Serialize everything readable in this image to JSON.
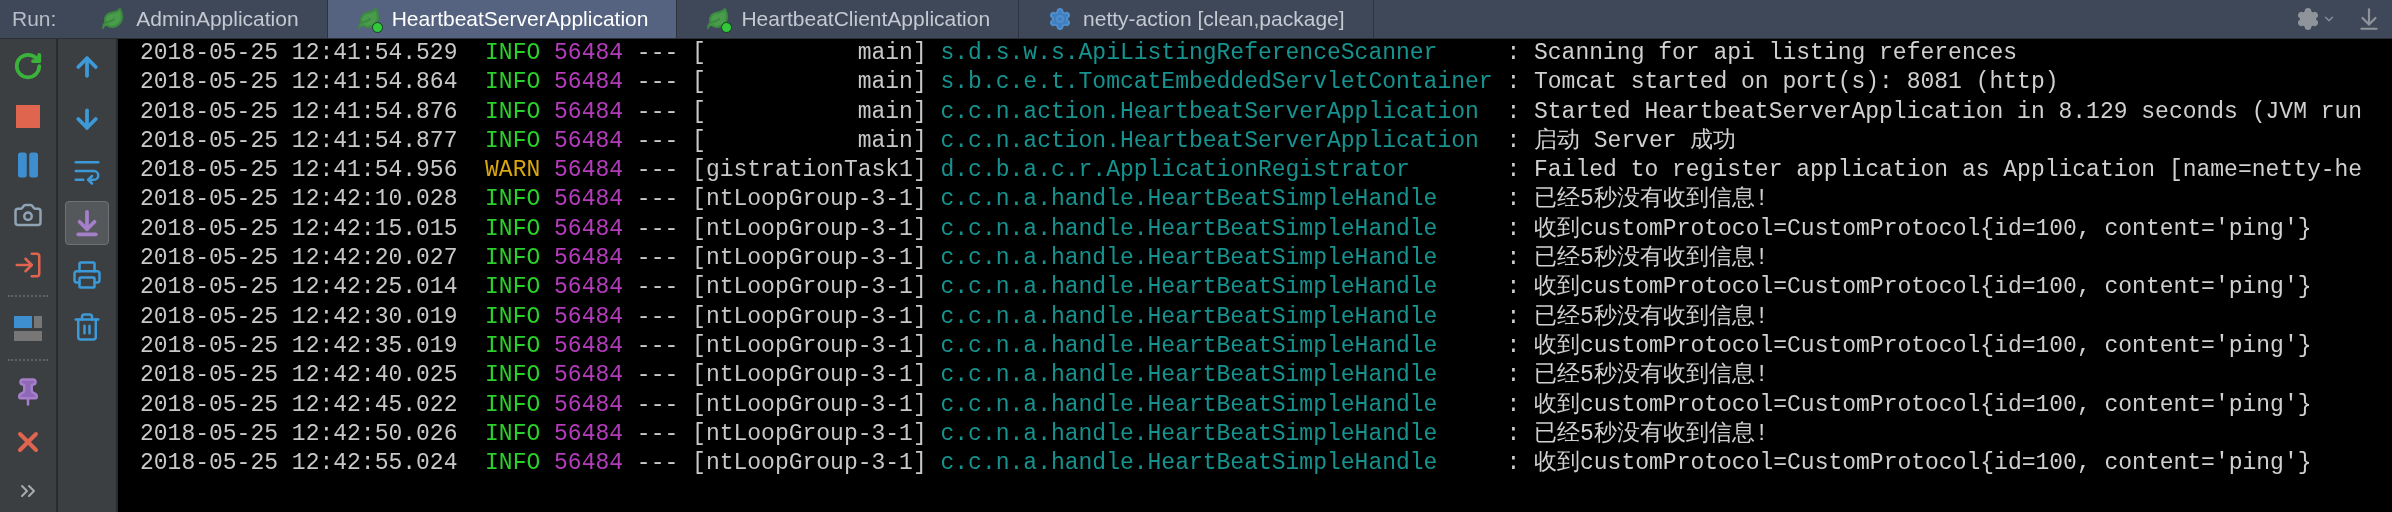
{
  "run_label": "Run:",
  "tabs": [
    {
      "label": "AdminApplication",
      "kind": "spring",
      "running": false,
      "selected": false
    },
    {
      "label": "HeartbeatServerApplication",
      "kind": "spring",
      "running": true,
      "selected": true
    },
    {
      "label": "HeartbeatClientApplication",
      "kind": "spring",
      "running": true,
      "selected": false
    },
    {
      "label": "netty-action [clean,package]",
      "kind": "maven",
      "running": false,
      "selected": false
    }
  ],
  "toolbar_left": [
    {
      "kind": "rerun"
    },
    {
      "kind": "stop"
    },
    {
      "kind": "pause"
    },
    {
      "kind": "camera"
    },
    {
      "kind": "exit"
    },
    {
      "kind": "sep"
    },
    {
      "kind": "layout"
    },
    {
      "kind": "sep"
    },
    {
      "kind": "pin"
    },
    {
      "kind": "close"
    },
    {
      "kind": "more"
    }
  ],
  "toolbar_right": [
    {
      "kind": "up",
      "selected": false
    },
    {
      "kind": "down",
      "selected": false
    },
    {
      "kind": "wrap",
      "selected": false
    },
    {
      "kind": "scroll-end",
      "selected": true
    },
    {
      "kind": "print",
      "selected": false
    },
    {
      "kind": "trash",
      "selected": false
    }
  ],
  "log": [
    {
      "time": "2018-05-25 12:41:54.529",
      "level": "INFO",
      "kind": "info",
      "pid": "56484",
      "dashes": "---",
      "thread": "[           main]",
      "logger": "s.d.s.w.s.ApiListingReferenceScanner",
      "message": ": Scanning for api listing references"
    },
    {
      "time": "2018-05-25 12:41:54.864",
      "level": "INFO",
      "kind": "info",
      "pid": "56484",
      "dashes": "---",
      "thread": "[           main]",
      "logger": "s.b.c.e.t.TomcatEmbeddedServletContainer",
      "message": ": Tomcat started on port(s): 8081 (http)"
    },
    {
      "time": "2018-05-25 12:41:54.876",
      "level": "INFO",
      "kind": "info",
      "pid": "56484",
      "dashes": "---",
      "thread": "[           main]",
      "logger": "c.c.n.action.HeartbeatServerApplication",
      "message": ": Started HeartbeatServerApplication in 8.129 seconds (JVM run"
    },
    {
      "time": "2018-05-25 12:41:54.877",
      "level": "INFO",
      "kind": "info",
      "pid": "56484",
      "dashes": "---",
      "thread": "[           main]",
      "logger": "c.c.n.action.HeartbeatServerApplication",
      "message": ": 启动 Server 成功"
    },
    {
      "time": "2018-05-25 12:41:54.956",
      "level": "WARN",
      "kind": "warn",
      "pid": "56484",
      "dashes": "---",
      "thread": "[gistrationTask1]",
      "logger": "d.c.b.a.c.r.ApplicationRegistrator",
      "message": ": Failed to register application as Application [name=netty-he"
    },
    {
      "time": "2018-05-25 12:42:10.028",
      "level": "INFO",
      "kind": "info",
      "pid": "56484",
      "dashes": "---",
      "thread": "[ntLoopGroup-3-1]",
      "logger": "c.c.n.a.handle.HeartBeatSimpleHandle",
      "message": ": 已经5秒没有收到信息!"
    },
    {
      "time": "2018-05-25 12:42:15.015",
      "level": "INFO",
      "kind": "info",
      "pid": "56484",
      "dashes": "---",
      "thread": "[ntLoopGroup-3-1]",
      "logger": "c.c.n.a.handle.HeartBeatSimpleHandle",
      "message": ": 收到customProtocol=CustomProtocol{id=100, content='ping'}"
    },
    {
      "time": "2018-05-25 12:42:20.027",
      "level": "INFO",
      "kind": "info",
      "pid": "56484",
      "dashes": "---",
      "thread": "[ntLoopGroup-3-1]",
      "logger": "c.c.n.a.handle.HeartBeatSimpleHandle",
      "message": ": 已经5秒没有收到信息!"
    },
    {
      "time": "2018-05-25 12:42:25.014",
      "level": "INFO",
      "kind": "info",
      "pid": "56484",
      "dashes": "---",
      "thread": "[ntLoopGroup-3-1]",
      "logger": "c.c.n.a.handle.HeartBeatSimpleHandle",
      "message": ": 收到customProtocol=CustomProtocol{id=100, content='ping'}"
    },
    {
      "time": "2018-05-25 12:42:30.019",
      "level": "INFO",
      "kind": "info",
      "pid": "56484",
      "dashes": "---",
      "thread": "[ntLoopGroup-3-1]",
      "logger": "c.c.n.a.handle.HeartBeatSimpleHandle",
      "message": ": 已经5秒没有收到信息!"
    },
    {
      "time": "2018-05-25 12:42:35.019",
      "level": "INFO",
      "kind": "info",
      "pid": "56484",
      "dashes": "---",
      "thread": "[ntLoopGroup-3-1]",
      "logger": "c.c.n.a.handle.HeartBeatSimpleHandle",
      "message": ": 收到customProtocol=CustomProtocol{id=100, content='ping'}"
    },
    {
      "time": "2018-05-25 12:42:40.025",
      "level": "INFO",
      "kind": "info",
      "pid": "56484",
      "dashes": "---",
      "thread": "[ntLoopGroup-3-1]",
      "logger": "c.c.n.a.handle.HeartBeatSimpleHandle",
      "message": ": 已经5秒没有收到信息!"
    },
    {
      "time": "2018-05-25 12:42:45.022",
      "level": "INFO",
      "kind": "info",
      "pid": "56484",
      "dashes": "---",
      "thread": "[ntLoopGroup-3-1]",
      "logger": "c.c.n.a.handle.HeartBeatSimpleHandle",
      "message": ": 收到customProtocol=CustomProtocol{id=100, content='ping'}"
    },
    {
      "time": "2018-05-25 12:42:50.026",
      "level": "INFO",
      "kind": "info",
      "pid": "56484",
      "dashes": "---",
      "thread": "[ntLoopGroup-3-1]",
      "logger": "c.c.n.a.handle.HeartBeatSimpleHandle",
      "message": ": 已经5秒没有收到信息!"
    },
    {
      "time": "2018-05-25 12:42:55.024",
      "level": "INFO",
      "kind": "info",
      "pid": "56484",
      "dashes": "---",
      "thread": "[ntLoopGroup-3-1]",
      "logger": "c.c.n.a.handle.HeartBeatSimpleHandle",
      "message": ": 收到customProtocol=CustomProtocol{id=100, content='ping'}"
    }
  ]
}
